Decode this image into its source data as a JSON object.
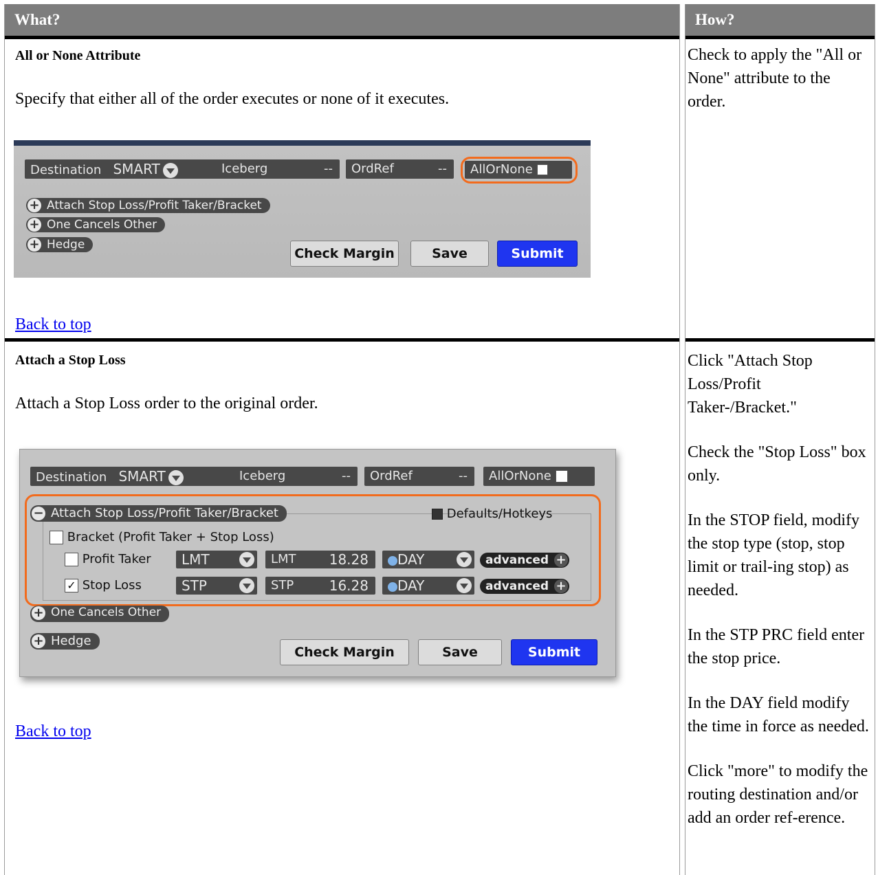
{
  "headers": {
    "what": "What?",
    "how": "How?"
  },
  "row1": {
    "title": "All or None Attribute",
    "desc": "Specify that either all of the order executes or none of it executes.",
    "back": "Back to top",
    "how": [
      "Check to apply the \"All or None\" attribute to the order."
    ],
    "shot": {
      "destination_label": "Destination",
      "destination_value": "SMART",
      "iceberg_label": "Iceberg",
      "iceberg_value": "--",
      "ordref_label": "OrdRef",
      "ordref_value": "--",
      "allornone_label": "AllOrNone",
      "attach_label": "Attach Stop Loss/Profit Taker/Bracket",
      "oco_label": "One Cancels Other",
      "hedge_label": "Hedge",
      "check_margin": "Check Margin",
      "save": "Save",
      "submit": "Submit"
    }
  },
  "row2": {
    "title": "Attach a Stop Loss",
    "desc": "Attach a Stop Loss order to the original order.",
    "back": "Back to top",
    "how": [
      "Click \"Attach Stop Loss/Profit Taker-/Bracket.\"",
      "Check the \"Stop Loss\" box only.",
      "In the STOP field, modify the stop type (stop, stop limit or trail-ing stop) as needed.",
      "In the STP PRC field enter the stop price.",
      "In the DAY field modify the time in force as needed.",
      "Click \"more\" to modify the routing destination and/or add an order ref-erence."
    ],
    "shot": {
      "destination_label": "Destination",
      "destination_value": "SMART",
      "iceberg_label": "Iceberg",
      "iceberg_value": "--",
      "ordref_label": "OrdRef",
      "ordref_value": "--",
      "allornone_label": "AllOrNone",
      "attach_label": "Attach Stop Loss/Profit Taker/Bracket",
      "defaults_label": "Defaults/Hotkeys",
      "bracket_label": "Bracket (Profit Taker + Stop Loss)",
      "profit_label": "Profit Taker",
      "profit_type": "LMT",
      "profit_price_label": "LMT",
      "profit_price": "18.28",
      "profit_tif": "DAY",
      "stop_label": "Stop Loss",
      "stop_type": "STP",
      "stop_price_label": "STP",
      "stop_price": "16.28",
      "stop_tif": "DAY",
      "advanced": "advanced",
      "oco_label": "One Cancels Other",
      "hedge_label": "Hedge",
      "check_margin": "Check Margin",
      "save": "Save",
      "submit": "Submit"
    }
  }
}
